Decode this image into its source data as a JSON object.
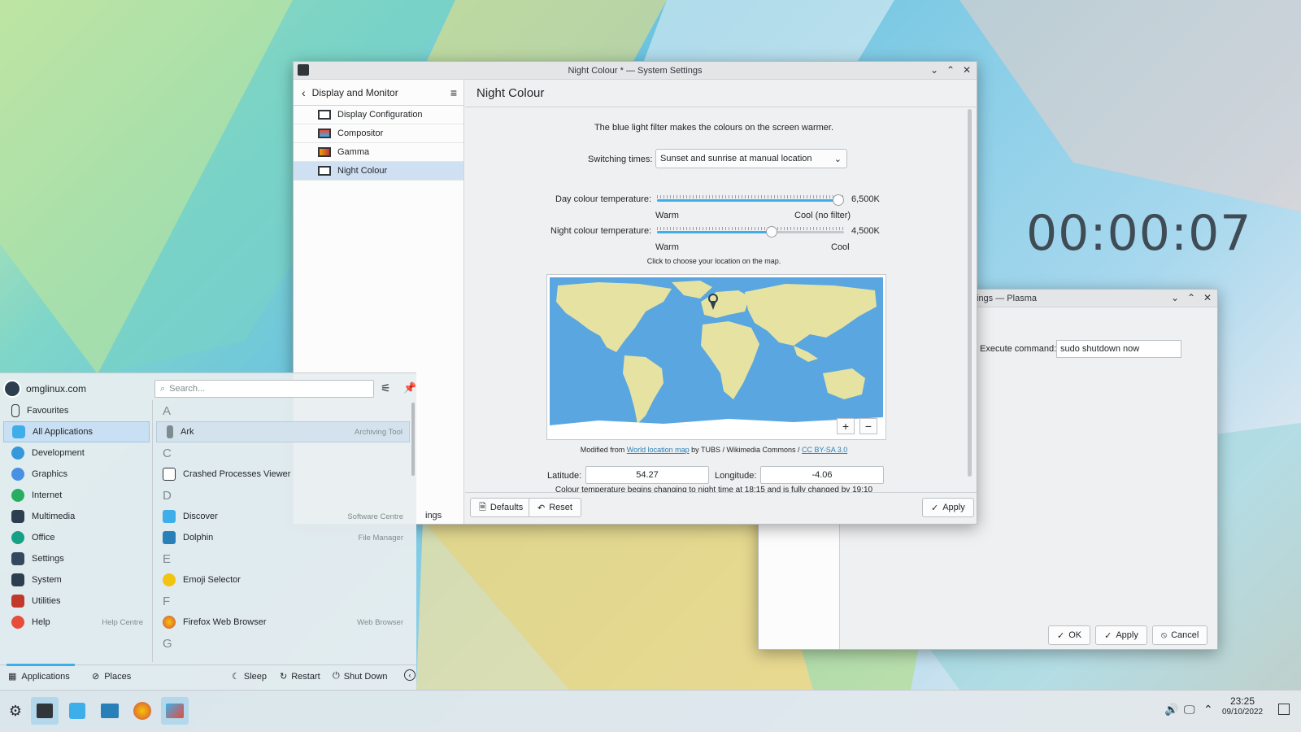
{
  "clock_widget": {
    "time": "00:00:07"
  },
  "night_window": {
    "title": "Night Colour * — System Settings",
    "sidebar": {
      "back_label": "Display and Monitor",
      "items": [
        {
          "label": "Display Configuration",
          "icon": "monitor-icon"
        },
        {
          "label": "Compositor",
          "icon": "compositor-icon"
        },
        {
          "label": "Gamma",
          "icon": "gamma-icon"
        },
        {
          "label": "Night Colour",
          "icon": "night-colour-icon",
          "selected": true
        }
      ],
      "bottom_partial": "ings"
    },
    "page_title": "Night Colour",
    "description": "The blue light filter makes the colours on the screen warmer.",
    "switching_label": "Switching times:",
    "switching_value": "Sunset and sunrise at manual location",
    "day": {
      "label": "Day colour temperature:",
      "value": "6,500K",
      "level": 1.0,
      "left": "Warm",
      "right": "Cool (no filter)"
    },
    "night": {
      "label": "Night colour temperature:",
      "value": "4,500K",
      "level": 0.62,
      "left": "Warm",
      "right": "Cool"
    },
    "map_hint": "Click to choose your location on the map.",
    "attribution": {
      "prefix": "Modified from ",
      "link1": "World location map",
      "middle": " by TUBS / Wikimedia Commons / ",
      "link2": "CC BY-SA 3.0"
    },
    "latitude_label": "Latitude:",
    "latitude": "54.27",
    "longitude_label": "Longitude:",
    "longitude": "-4.06",
    "status_partial": "Colour temperature begins changing to night time at 18:15 and is fully changed by 19:10",
    "buttons": {
      "defaults": "Defaults",
      "reset": "Reset",
      "apply": "Apply"
    },
    "zoom": {
      "in": "+",
      "out": "−"
    }
  },
  "plasma_window": {
    "title": "ings — Plasma",
    "exec_label": "Execute command:",
    "exec_value": "sudo shutdown now",
    "buttons": {
      "ok": "OK",
      "apply": "Apply",
      "cancel": "Cancel"
    }
  },
  "menu": {
    "user": "omglinux.com",
    "search_placeholder": "Search...",
    "categories": [
      {
        "label": "Favourites",
        "icon": "bookmark-icon",
        "color": "#ffffff"
      },
      {
        "label": "All Applications",
        "icon": "grid-icon",
        "color": "#3daee9",
        "selected": true
      },
      {
        "label": "Development",
        "icon": "development-icon",
        "color": "#3498db"
      },
      {
        "label": "Graphics",
        "icon": "graphics-icon",
        "color": "#4a90e2"
      },
      {
        "label": "Internet",
        "icon": "internet-icon",
        "color": "#27ae60"
      },
      {
        "label": "Multimedia",
        "icon": "multimedia-icon",
        "color": "#2c3e50"
      },
      {
        "label": "Office",
        "icon": "office-icon",
        "color": "#16a085"
      },
      {
        "label": "Settings",
        "icon": "settings-icon",
        "color": "#34495e"
      },
      {
        "label": "System",
        "icon": "system-icon",
        "color": "#2c3e50"
      },
      {
        "label": "Utilities",
        "icon": "utilities-icon",
        "color": "#c0392b"
      },
      {
        "label": "Help",
        "icon": "help-icon",
        "color": "#e74c3c",
        "desc": "Help Centre"
      }
    ],
    "apps": [
      {
        "letter": "A"
      },
      {
        "label": "Ark",
        "desc": "Archiving Tool",
        "icon": "ark-icon",
        "color": "#7f8c8d",
        "selected": true
      },
      {
        "letter": "C"
      },
      {
        "label": "Crashed Processes Viewer",
        "desc": "",
        "icon": "crash-icon",
        "color": "#bdc3c7"
      },
      {
        "letter": "D"
      },
      {
        "label": "Discover",
        "desc": "Software Centre",
        "icon": "discover-icon",
        "color": "#3daee9"
      },
      {
        "label": "Dolphin",
        "desc": "File Manager",
        "icon": "dolphin-icon",
        "color": "#2980b9"
      },
      {
        "letter": "E"
      },
      {
        "label": "Emoji Selector",
        "desc": "",
        "icon": "emoji-icon",
        "color": "#f1c40f"
      },
      {
        "letter": "F"
      },
      {
        "label": "Firefox Web Browser",
        "desc": "Web Browser",
        "icon": "firefox-icon",
        "color": "#e67e22"
      },
      {
        "letter": "G"
      }
    ],
    "footer": {
      "applications": "Applications",
      "places": "Places",
      "sleep": "Sleep",
      "restart": "Restart",
      "shutdown": "Shut Down"
    }
  },
  "taskbar": {
    "time": "23:25",
    "date": "09/10/2022"
  }
}
